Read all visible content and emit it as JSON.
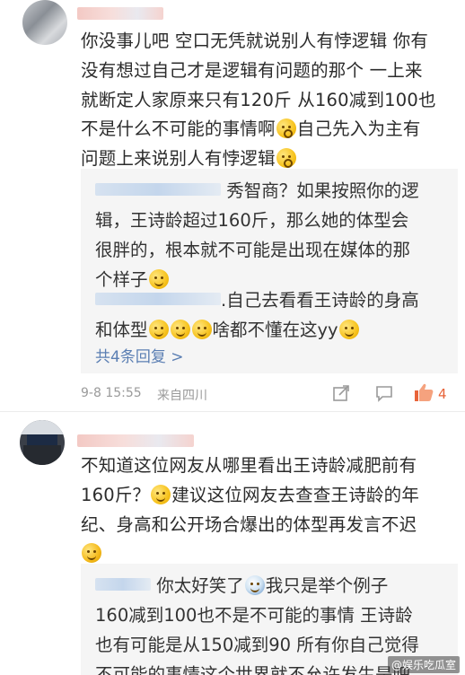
{
  "comment1": {
    "text_lines": [
      "你没事儿吧 空口无凭就说别人有悖逻辑 你有",
      "没有想过自己才是逻辑有问题的那个 一上来",
      "就断定人家原来只有120斤 从160减到100也",
      "不是什么不可能的事情啊",
      "自己先入为主有",
      "问题上来说别人有悖逻辑"
    ],
    "replies": [
      {
        "lines": [
          "秀智商？如果按照你的逻",
          "辑，王诗龄超过160斤，那么她的体型会",
          "很胖的，根本就不可能是出现在媒体的那",
          "个样子"
        ]
      },
      {
        "lines": [
          ".自己去看看王诗龄的身高",
          "和体型",
          "啥都不懂在这yy"
        ]
      }
    ],
    "more_replies": "共4条回复 >",
    "timestamp": "9-8 15:55",
    "source": "来自四川",
    "like_count": "4"
  },
  "comment2": {
    "text_lines": [
      "不知道这位网友从哪里看出王诗龄减肥前有",
      "160斤？",
      "建议这位网友去查查王诗龄的年",
      "纪、身高和公开场合爆出的体型再发言不迟"
    ],
    "reply": {
      "lines": [
        "你太好笑了",
        "我只是举个例子",
        "160减到100也不是不可能的事情 王诗龄",
        "也有可能是从150减到90 所有你自己觉得",
        "不可能的事情这个世界就不允许发生是吧"
      ]
    }
  },
  "watermark": "@娱乐吃瓜室",
  "icons": {
    "share": "share-icon",
    "comment": "comment-icon",
    "like": "thumbs-up-icon"
  },
  "colors": {
    "link": "#5b7fb3",
    "like": "#e8643a",
    "meta": "#9a9a9a",
    "reply_bg": "#f5f5f5"
  }
}
